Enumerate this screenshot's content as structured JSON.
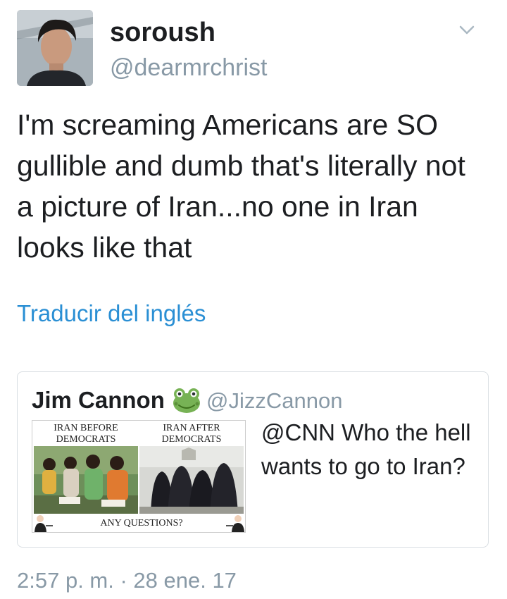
{
  "tweet": {
    "display_name": "soroush",
    "handle": "@dearmrchrist",
    "avatar_icon": "profile-photo",
    "text": "I'm screaming Americans are SO gullible and dumb that's literally not a picture of Iran...no one in Iran looks like that",
    "translate_label": "Traducir del inglés",
    "timestamp": "2:57 p. m. · 28 ene. 17",
    "menu_icon": "chevron-down-icon"
  },
  "quoted_tweet": {
    "display_name": "Jim Cannon",
    "emoji_icon": "frog-emoji",
    "handle": "@JizzCannon",
    "text": "@CNN Who the hell wants to go to Iran?",
    "meme": {
      "label_before": "IRAN BEFORE DEMOCRATS",
      "label_after": "IRAN AFTER DEMOCRATS",
      "footer": "ANY QUESTIONS?"
    }
  },
  "colors": {
    "link_blue": "#2a8fd4",
    "muted_gray": "#8899a6",
    "border": "#d9dee3"
  }
}
